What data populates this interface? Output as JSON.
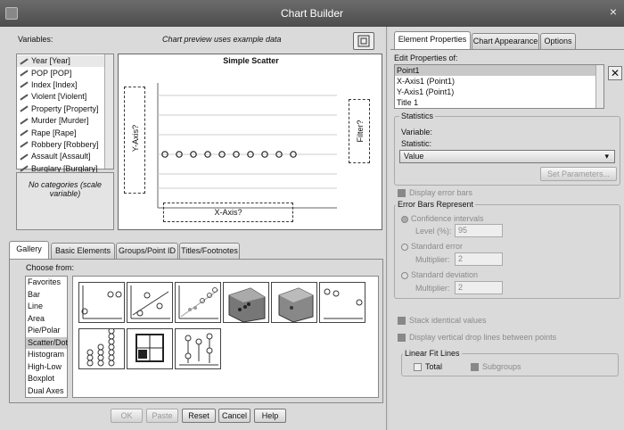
{
  "window": {
    "title": "Chart Builder",
    "close": "×"
  },
  "variables": {
    "label": "Variables:",
    "items": [
      "Year [Year]",
      "POP [POP]",
      "Index [Index]",
      "Violent [Violent]",
      "Property [Property]",
      "Murder [Murder]",
      "Rape [Rape]",
      "Robbery [Robbery]",
      "Assault [Assault]",
      "Burglary [Burglary]"
    ],
    "no_categories": "No categories (scale variable)"
  },
  "preview": {
    "note": "Chart preview uses example data",
    "chart_title": "Simple Scatter",
    "y_axis": "Y-Axis?",
    "x_axis": "X-Axis?",
    "filter": "Filter?"
  },
  "tabs_bottom": [
    "Gallery",
    "Basic Elements",
    "Groups/Point ID",
    "Titles/Footnotes"
  ],
  "gallery": {
    "choose_from": "Choose from:",
    "types": [
      "Favorites",
      "Bar",
      "Line",
      "Area",
      "Pie/Polar",
      "Scatter/Dot",
      "Histogram",
      "High-Low",
      "Boxplot",
      "Dual Axes"
    ],
    "selected_type": "Scatter/Dot"
  },
  "buttons": {
    "ok": "OK",
    "paste": "Paste",
    "reset": "Reset",
    "cancel": "Cancel",
    "help": "Help"
  },
  "right": {
    "tabs": [
      "Element Properties",
      "Chart Appearance",
      "Options"
    ],
    "edit_label": "Edit Properties of:",
    "properties": [
      "Point1",
      "X-Axis1 (Point1)",
      "Y-Axis1 (Point1)",
      "Title 1"
    ],
    "statistics_title": "Statistics",
    "variable_label": "Variable:",
    "statistic_label": "Statistic:",
    "statistic_value": "Value",
    "set_parameters": "Set Parameters...",
    "display_error_bars": "Display error bars",
    "error_bars_title": "Error Bars Represent",
    "confidence": "Confidence intervals",
    "level_label": "Level (%):",
    "level_value": "95",
    "std_error": "Standard error",
    "multiplier_label": "Multiplier:",
    "multiplier1": "2",
    "std_dev": "Standard deviation",
    "multiplier2": "2",
    "stack_identical": "Stack identical values",
    "drop_lines": "Display vertical drop lines between points",
    "linear_fit_title": "Linear Fit Lines",
    "total": "Total",
    "subgroups": "Subgroups"
  }
}
